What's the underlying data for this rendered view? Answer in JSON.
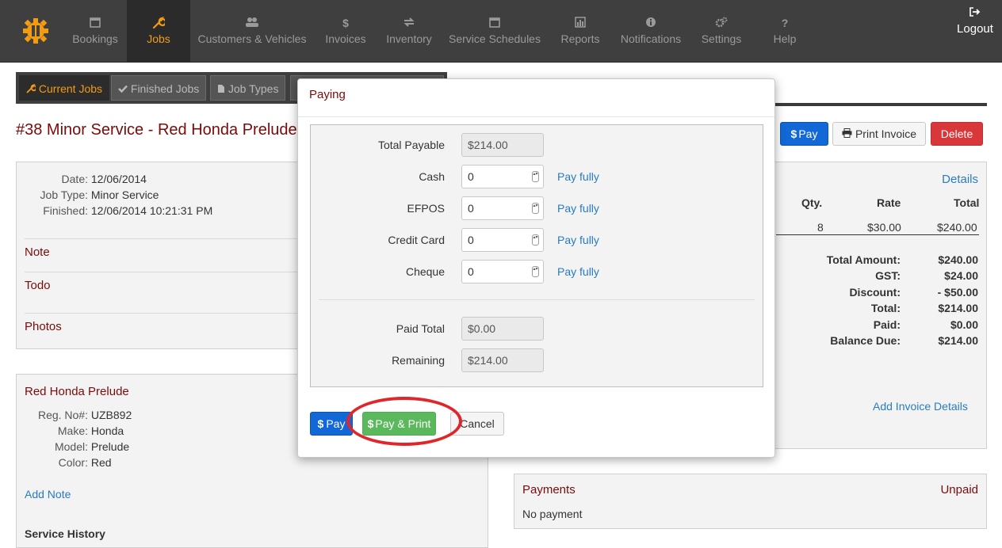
{
  "nav": {
    "items": [
      {
        "label": "Bookings",
        "icon": "calendar-icon"
      },
      {
        "label": "Jobs",
        "icon": "wrench-icon"
      },
      {
        "label": "Customers & Vehicles",
        "icon": "users-icon"
      },
      {
        "label": "Invoices",
        "icon": "dollar-icon"
      },
      {
        "label": "Inventory",
        "icon": "exchange-icon"
      },
      {
        "label": "Service Schedules",
        "icon": "calendar-icon"
      },
      {
        "label": "Reports",
        "icon": "bar-chart-icon"
      },
      {
        "label": "Notifications",
        "icon": "info-icon"
      },
      {
        "label": "Settings",
        "icon": "gears-icon"
      },
      {
        "label": "Help",
        "icon": "question-icon"
      }
    ],
    "logout": "Logout",
    "active_color": "#f39c12"
  },
  "subtabs": {
    "current": "Current Jobs",
    "finished": "Finished Jobs",
    "types": "Job Types"
  },
  "page": {
    "title": "#38 Minor Service - Red Honda Prelude",
    "pay": "Pay",
    "print_invoice": "Print Invoice",
    "delete": "Delete"
  },
  "job": {
    "date_label": "Date:",
    "date": "12/06/2014",
    "type_label": "Job Type:",
    "type": "Minor Service",
    "finished_label": "Finished:",
    "finished": "12/06/2014 10:21:31 PM",
    "note": "Note",
    "todo": "Todo",
    "photos": "Photos"
  },
  "vehicle": {
    "title": "Red Honda Prelude",
    "reg_label": "Reg. No#:",
    "reg": "UZB892",
    "make_label": "Make:",
    "make": "Honda",
    "model_label": "Model:",
    "model": "Prelude",
    "color_label": "Color:",
    "color": "Red",
    "add_note": "Add Note",
    "service_history": "Service History"
  },
  "invoice": {
    "details": "Details",
    "headers": {
      "qty": "Qty.",
      "rate": "Rate",
      "total": "Total"
    },
    "row": {
      "qty": "8",
      "rate": "$30.00",
      "total": "$240.00"
    },
    "totals": [
      {
        "label": "Total Amount:",
        "value": "$240.00"
      },
      {
        "label": "GST:",
        "value": "$24.00"
      },
      {
        "label": "Discount:",
        "value": "- $50.00"
      },
      {
        "label": "Total:",
        "value": "$214.00"
      },
      {
        "label": "Paid:",
        "value": "$0.00"
      },
      {
        "label": "Balance Due:",
        "value": "$214.00"
      }
    ],
    "add_details": "Add Invoice Details"
  },
  "payments": {
    "title": "Payments",
    "status": "Unpaid",
    "empty": "No payment"
  },
  "modal": {
    "title": "Paying",
    "total_payable_label": "Total Payable",
    "total_payable": "$214.00",
    "methods": [
      {
        "label": "Cash",
        "value": "0",
        "action": "Pay fully"
      },
      {
        "label": "EFPOS",
        "value": "0",
        "action": "Pay fully"
      },
      {
        "label": "Credit Card",
        "value": "0",
        "action": "Pay fully"
      },
      {
        "label": "Cheque",
        "value": "0",
        "action": "Pay fully"
      }
    ],
    "paid_total_label": "Paid Total",
    "paid_total": "$0.00",
    "remaining_label": "Remaining",
    "remaining": "$214.00",
    "pay": "Pay",
    "pay_print": "Pay & Print",
    "cancel": "Cancel"
  }
}
